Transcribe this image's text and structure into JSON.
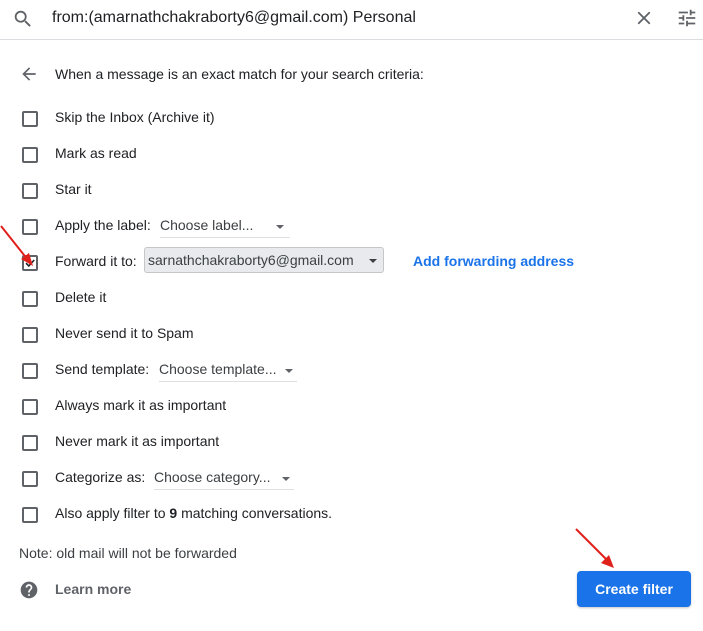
{
  "search": {
    "query": "from:(amarnathchakraborty6@gmail.com) Personal",
    "icons": [
      "search-icon",
      "close-icon",
      "search-options-icon"
    ]
  },
  "header": {
    "back_icon": "arrow-back-icon",
    "text": "When a message is an exact match for your search criteria:"
  },
  "options": [
    {
      "label": "Skip the Inbox (Archive it)",
      "checked": false
    },
    {
      "label": "Mark as read",
      "checked": false
    },
    {
      "label": "Star it",
      "checked": false
    },
    {
      "label": "Apply the label:",
      "checked": false,
      "dropdown": "Choose label..."
    },
    {
      "label": "Forward it to:",
      "checked": true,
      "dropdown": "sarnathchakraborty6@gmail.com",
      "link": "Add forwarding address"
    },
    {
      "label": "Delete it",
      "checked": false
    },
    {
      "label": "Never send it to Spam",
      "checked": false
    },
    {
      "label": "Send template:",
      "checked": false,
      "dropdown": "Choose template..."
    },
    {
      "label": "Always mark it as important",
      "checked": false
    },
    {
      "label": "Never mark it as important",
      "checked": false
    },
    {
      "label": "Categorize as:",
      "checked": false,
      "dropdown": "Choose category..."
    },
    {
      "label_before": "Also apply filter to ",
      "count": "9",
      "label_after": " matching conversations.",
      "checked": false
    }
  ],
  "note": "Note: old mail will not be forwarded",
  "footer": {
    "help_icon": "help-icon",
    "learn_more": "Learn more",
    "create_filter": "Create filter"
  },
  "colors": {
    "accent": "#1a73e8",
    "annotation_arrow": "#e0201b",
    "text": "#202124"
  }
}
